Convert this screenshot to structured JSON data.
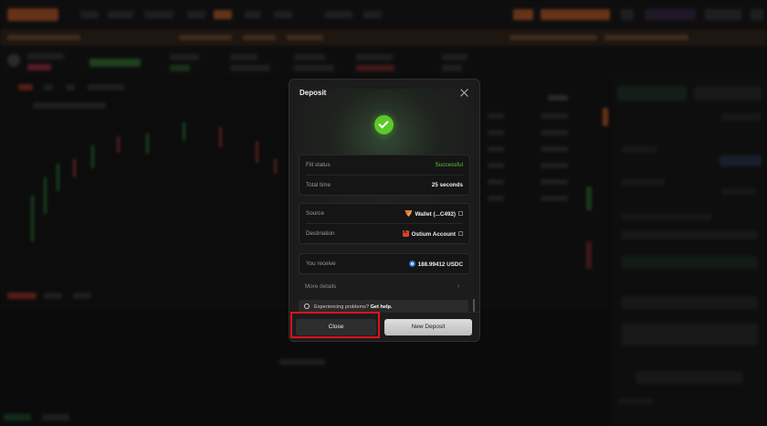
{
  "modal": {
    "title": "Deposit",
    "fill_status_label": "Fill status",
    "fill_status_value": "Successful",
    "total_time_label": "Total time",
    "total_time_value": "25 seconds",
    "source_label": "Source",
    "source_value": "Wallet (...C492)",
    "destination_label": "Destination",
    "destination_value": "Ostium Account",
    "receive_label": "You receive",
    "receive_value": "188.99412 USDC",
    "more_details": "More details",
    "help_text": "Experiencing problems?",
    "help_link": "Get help.",
    "close_button": "Close",
    "new_deposit_button": "New Deposit"
  },
  "colors": {
    "success": "#5cc82b",
    "highlight": "#e3121b",
    "accent": "#e06a2c"
  },
  "icons": [
    "close-icon",
    "success-check-icon",
    "wallet-icon",
    "ostium-icon",
    "usdc-icon",
    "external-link-icon",
    "chevron-right-icon",
    "info-icon"
  ]
}
